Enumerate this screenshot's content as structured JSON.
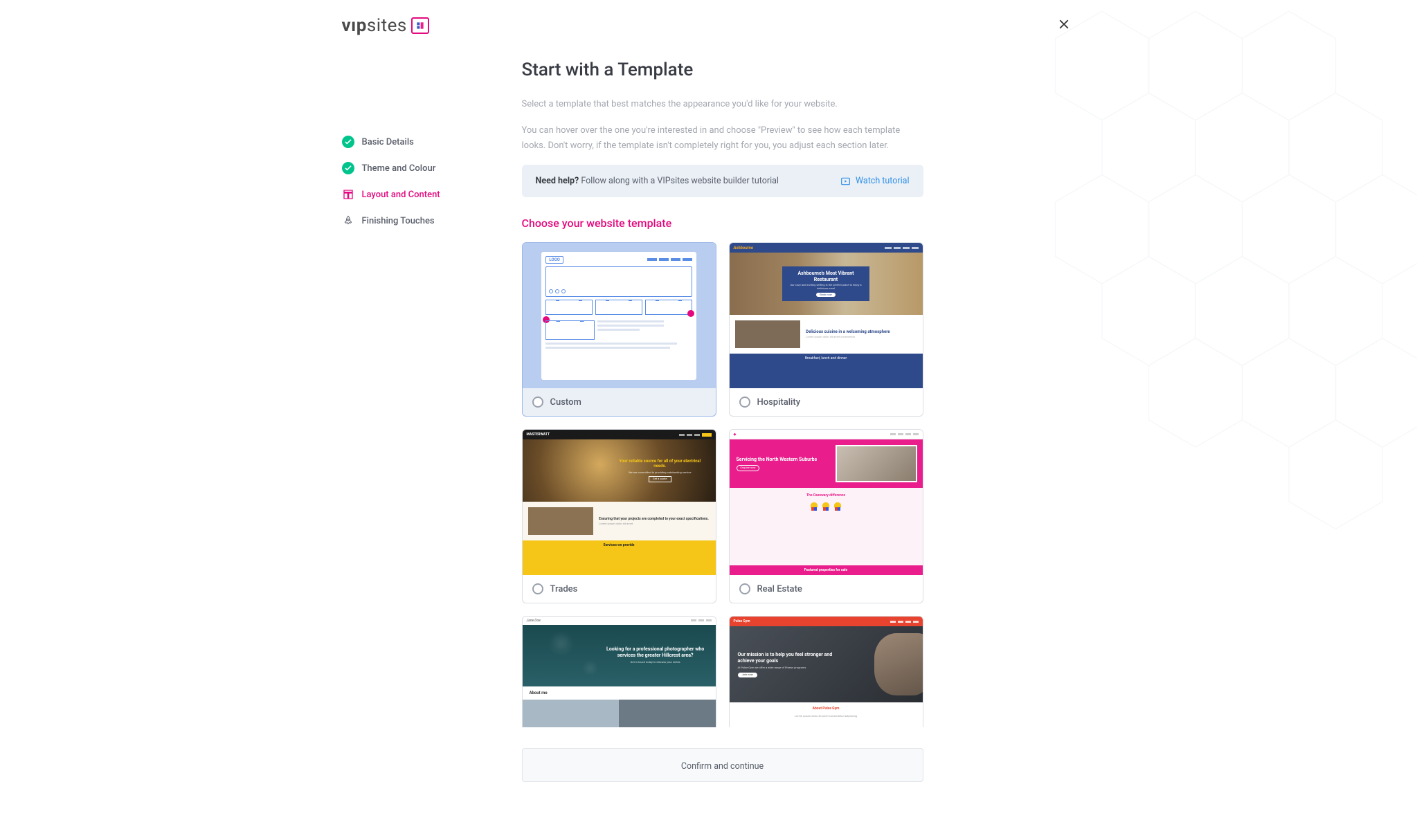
{
  "logo": {
    "text_prefix": "vıp",
    "text_suffix": "sites"
  },
  "steps": [
    {
      "label": "Basic Details",
      "state": "done"
    },
    {
      "label": "Theme and Colour",
      "state": "done"
    },
    {
      "label": "Layout and Content",
      "state": "active"
    },
    {
      "label": "Finishing Touches",
      "state": "upcoming"
    }
  ],
  "page": {
    "title": "Start with a Template",
    "desc1": "Select a template that best matches the appearance you'd like for your website.",
    "desc2": "You can hover over the one you're interested in and choose \"Preview\" to see how each template looks. Don't worry, if the template isn't completely right for you, you adjust each section later."
  },
  "help": {
    "bold": "Need help?",
    "text": " Follow along with a VIPsites website builder tutorial",
    "link": "Watch tutorial"
  },
  "section_title": "Choose your website template",
  "templates": [
    {
      "label": "Custom",
      "selected": true
    },
    {
      "label": "Hospitality",
      "selected": false
    },
    {
      "label": "Trades",
      "selected": false
    },
    {
      "label": "Real Estate",
      "selected": false
    }
  ],
  "templates_row3": {
    "photography_visible": true,
    "gym_visible": true
  },
  "confirm": {
    "label": "Confirm and continue"
  },
  "thumb": {
    "custom_logo": "LOGO",
    "hosp_logo": "Ashbourne",
    "hosp_hero_title": "Ashbourne's Most Vibrant Restaurant",
    "hosp_hero_btn": "Book now",
    "hosp_mid_title": "Delicious cuisine in a welcoming atmosphere",
    "hosp_band": "Breakfast, lunch and dinner",
    "trades_logo": "MASTERWATT",
    "trades_hero_title": "Your reliable source for all of your electrical needs.",
    "trades_hero_btn": "Get a quote",
    "trades_mid_title": "Ensuring that your projects are completed to your exact specifications.",
    "trades_band": "Services we provide",
    "re_hero_title": "Servicing the North Western Suburbs",
    "re_hero_btn": "Enquire now",
    "re_mid_title": "The Casowary difference",
    "re_band": "Featured properties for sale",
    "photo_logo": "Jane Doe",
    "photo_hero_title": "Looking for a professional photographer who services the greater Hillcrest area?",
    "photo_about": "About me",
    "gym_logo": "Pulse Gym",
    "gym_hero_title": "Our mission is to help you feel stronger and achieve your goals",
    "gym_hero_btn": "Join now",
    "gym_band": "About Pulse Gym"
  }
}
